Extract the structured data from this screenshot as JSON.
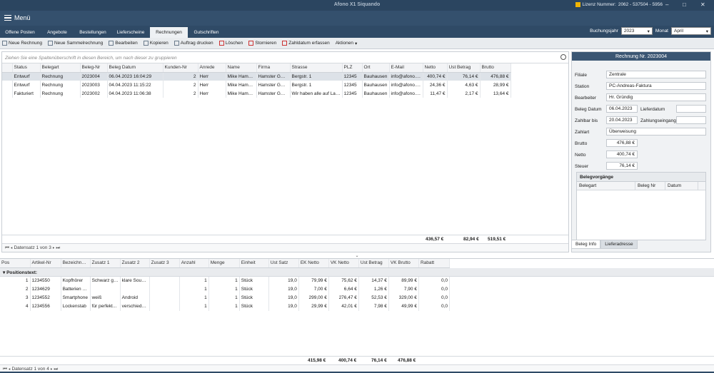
{
  "window": {
    "title": "Afono X1 Siquando",
    "license_label": "Lizenz Nummer:",
    "license_number": "2062 - 537504 - 5956",
    "minimize": "–",
    "maximize": "□",
    "close": "✕"
  },
  "menu": {
    "label": "Menü"
  },
  "tabs": [
    "Offene Posten",
    "Angebote",
    "Bestellungen",
    "Lieferscheine",
    "Rechnungen",
    "Gutschriften"
  ],
  "period": {
    "year_label": "Buchungsjahr",
    "year": "2023",
    "month_label": "Monat",
    "month": "April"
  },
  "toolbar": [
    "Neue Rechnung",
    "Neue Sammelrechnung",
    "Bearbeiten",
    "Kopieren",
    "Auftrag drucken",
    "Löschen",
    "Stornieren",
    "Zahldatum erfassen",
    "Aktionen"
  ],
  "invoices": {
    "group_hint": "Ziehen Sie eine Spaltenüberschrift in diesen Bereich, um nach dieser zu gruppieren",
    "columns": [
      "Status",
      "Belegart",
      "Beleg-Nr",
      "Beleg Datum",
      "Kunden-Nr",
      "Anrede",
      "Name",
      "Firma",
      "Strasse",
      "PLZ",
      "Ort",
      "E-Mail",
      "Netto",
      "Ust Betrag",
      "Brutto"
    ],
    "rows": [
      [
        "Entwurf",
        "Rechnung",
        "2023004",
        "06.04.2023 16:04:29",
        "2",
        "Herr",
        "Mike Hamster",
        "Hamster GmbH",
        "Bergstr. 1",
        "12345",
        "Bauhausen",
        "info@afono.de",
        "400,74 €",
        "76,14 €",
        "476,88 €"
      ],
      [
        "Entwurf",
        "Rechnung",
        "2023003",
        "04.04.2023 11:15:22",
        "2",
        "Herr",
        "Mike Hamster",
        "Hamster GmbH",
        "Bergstr. 1",
        "12345",
        "Bauhausen",
        "info@afono.de",
        "24,36 €",
        "4,63 €",
        "28,99 €"
      ],
      [
        "Fakturiert",
        "Rechnung",
        "2023002",
        "04.04.2023 11:06:38",
        "2",
        "Herr",
        "Mike Hamster",
        "Hamster GmbH",
        "Wir haben alle auf Lager",
        "12345",
        "Bauhausen",
        "info@afono.de",
        "11,47 €",
        "2,17 €",
        "13,64 €"
      ]
    ],
    "totals": {
      "netto": "436,57 €",
      "ust": "82,94 €",
      "brutto": "519,51 €"
    },
    "nav": "Datensatz 1 von 3"
  },
  "detail": {
    "header": "Rechnung Nr. 2023004",
    "filiale_label": "Filiale",
    "filiale": "Zentrale",
    "station_label": "Station",
    "station": "PC-Andreas-Faktura",
    "bearbeiter_label": "Bearbeiter",
    "bearbeiter": "Hr. Gründig",
    "belegdatum_label": "Beleg Datum",
    "belegdatum": "06.04.2023",
    "lieferdatum_label": "Lieferdatum",
    "lieferdatum": "",
    "zahlbar_label": "Zahlbar bis",
    "zahlbar": "20.04.2023",
    "zahlungseingang_label": "Zahlungseingang",
    "zahlungseingang": "",
    "zahlart_label": "Zahlart",
    "zahlart": "Überweisung",
    "brutto_label": "Brutto",
    "brutto": "476,88 €",
    "netto_label": "Netto",
    "netto": "400,74 €",
    "steuer_label": "Steuer",
    "steuer": "76,14 €",
    "vorgaenge_title": "Belegvorgänge",
    "vorgaenge_cols": [
      "Belegart",
      "Beleg Nr",
      "Datum"
    ],
    "tab_info": "Beleg Info",
    "tab_address": "Lieferadresse"
  },
  "positions": {
    "columns": [
      "Pos",
      "Artikel-Nr",
      "Bezeichnung",
      "Zusatz 1",
      "Zusatz 2",
      "Zusatz 3",
      "Anzahl",
      "Menge",
      "Einheit",
      "Ust Satz",
      "EK Netto",
      "VK Netto",
      "Ust Betrag",
      "VK Brutto",
      "Rabatt"
    ],
    "group_label": "Positionstext:",
    "rows": [
      [
        "1",
        "1234550",
        "Kopfhörer",
        "Schwarz gold",
        "klare Soun...",
        "",
        "1",
        "1",
        "Stück",
        "19,0",
        "79,99 €",
        "75,62 €",
        "14,37 €",
        "89,99 €",
        "0,0"
      ],
      [
        "2",
        "1234629",
        "Batterien V...",
        "",
        "",
        "",
        "1",
        "1",
        "Stück",
        "19,0",
        "7,00 €",
        "6,64 €",
        "1,26 €",
        "7,90 €",
        "0,0"
      ],
      [
        "3",
        "1234552",
        "Smartphone",
        "weiß",
        "Android",
        "",
        "1",
        "1",
        "Stück",
        "19,0",
        "299,00 €",
        "276,47 €",
        "52,53 €",
        "329,00 €",
        "0,0"
      ],
      [
        "4",
        "1234556",
        "Lockenstab",
        "für perfekt...",
        "verschiede...",
        "",
        "1",
        "1",
        "Stück",
        "19,0",
        "29,99 €",
        "42,01 €",
        "7,98 €",
        "49,99 €",
        "0,0"
      ]
    ],
    "totals": {
      "ek": "415,98 €",
      "vk": "400,74 €",
      "ust": "76,14 €",
      "brutto": "476,88 €"
    },
    "nav": "Datensatz 1 von 4"
  }
}
